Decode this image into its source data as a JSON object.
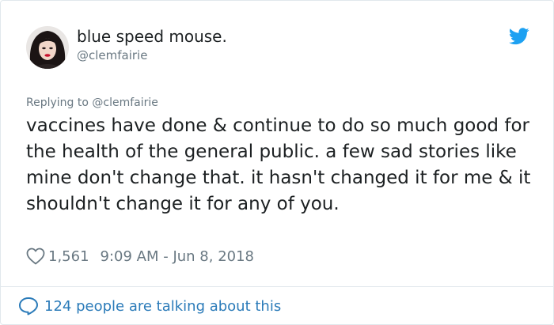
{
  "author": {
    "display_name": "blue speed mouse.",
    "handle": "@clemfairie",
    "avatar_icon": "profile-photo",
    "platform_icon": "twitter-bird-icon"
  },
  "reply": {
    "text": "Replying to @clemfairie"
  },
  "tweet": {
    "text": "vaccines have done & continue to do so much good for the health of the general public. a few sad stories like mine don't change that. it hasn't changed it for me & it shouldn't change it for any of you."
  },
  "meta": {
    "likes": "1,561",
    "timestamp": "9:09 AM - Jun 8, 2018"
  },
  "footer": {
    "talking": "124 people are talking about this"
  },
  "colors": {
    "accent": "#1da1f2",
    "link": "#2b7bb9",
    "muted": "#697882",
    "text": "#1c2022",
    "lipstick": "#c8102e"
  }
}
